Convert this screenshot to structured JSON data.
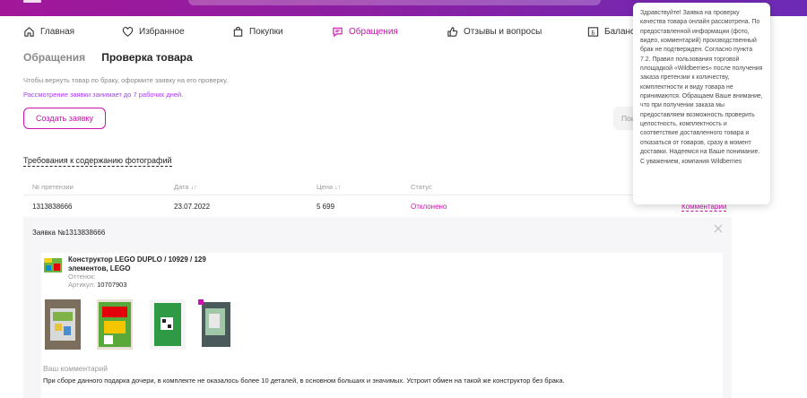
{
  "nav": {
    "items": [
      {
        "label": "Главная",
        "icon": "home-icon"
      },
      {
        "label": "Избранное",
        "icon": "heart-icon"
      },
      {
        "label": "Покупки",
        "icon": "bag-icon"
      },
      {
        "label": "Обращения",
        "icon": "chat-icon",
        "active": true
      },
      {
        "label": "Отзывы и вопросы",
        "icon": "thumb-icon"
      },
      {
        "label": "Баланс",
        "icon": "wallet-icon"
      }
    ],
    "active_color": "#cb11ab"
  },
  "tabs": {
    "appeals": "Обращения",
    "check": "Проверка товара"
  },
  "hints": {
    "line1": "Чтобы вернуть товар по браку, оформите заявку на его проверку.",
    "line2": "Рассмотрение заявки занимает до 7 рабочих дней."
  },
  "create_button": "Создать заявку",
  "search_placeholder": "Пои",
  "requirements_link": "Требования к содержанию фотографий",
  "table": {
    "headers": {
      "claim_no": "№ претензии",
      "date": "Дата",
      "price": "Цена",
      "status": "Статус"
    },
    "sort_glyph": "↓↑",
    "row": {
      "claim_no": "1313838666",
      "date": "23.07.2022",
      "price": "5 699",
      "status": "Отклонено",
      "comment_link": "Комментарий"
    }
  },
  "claim": {
    "title": "Заявка №1313838666",
    "product_name": "Конструктор LEGO DUPLO / 10929 / 129 элементов, LEGO",
    "shade_label": "Оттенок:",
    "article_label": "Артикул:",
    "article_value": "10707903",
    "comment_label": "Ваш комментарий",
    "comment_text": "При сборе данного подарка дочери, в комплекте не оказалось более 10 деталей, в основном больших и значимых. Устроит обмен на такой же конструктор без брака."
  },
  "tooltip": {
    "text": "Здравствуйте! Заявка на проверку качества товара онлайн рассмотрена. По предоставленной информации (фото, видео, комментарий) производственный брак не подтвержден. Согласно пункта 7.2. Правил пользования торговой площадкой «Wildberries» после получения заказа претензии к количеству, комплектности и виду товара не принимаются. Обращаем Ваше внимание, что при получении заказа мы предоставляем возможность проверить целостность, комплектность и соответствие доставленного товара и отказаться от товаров, сразу в момент доставки. Надеемся на Ваше понимание. С уважением, компания Wildberries"
  },
  "colors": {
    "brand": "#cb11ab",
    "header_from": "#a2179a",
    "header_to": "#6c2bb6",
    "panel_bg": "#f6f6f9"
  }
}
